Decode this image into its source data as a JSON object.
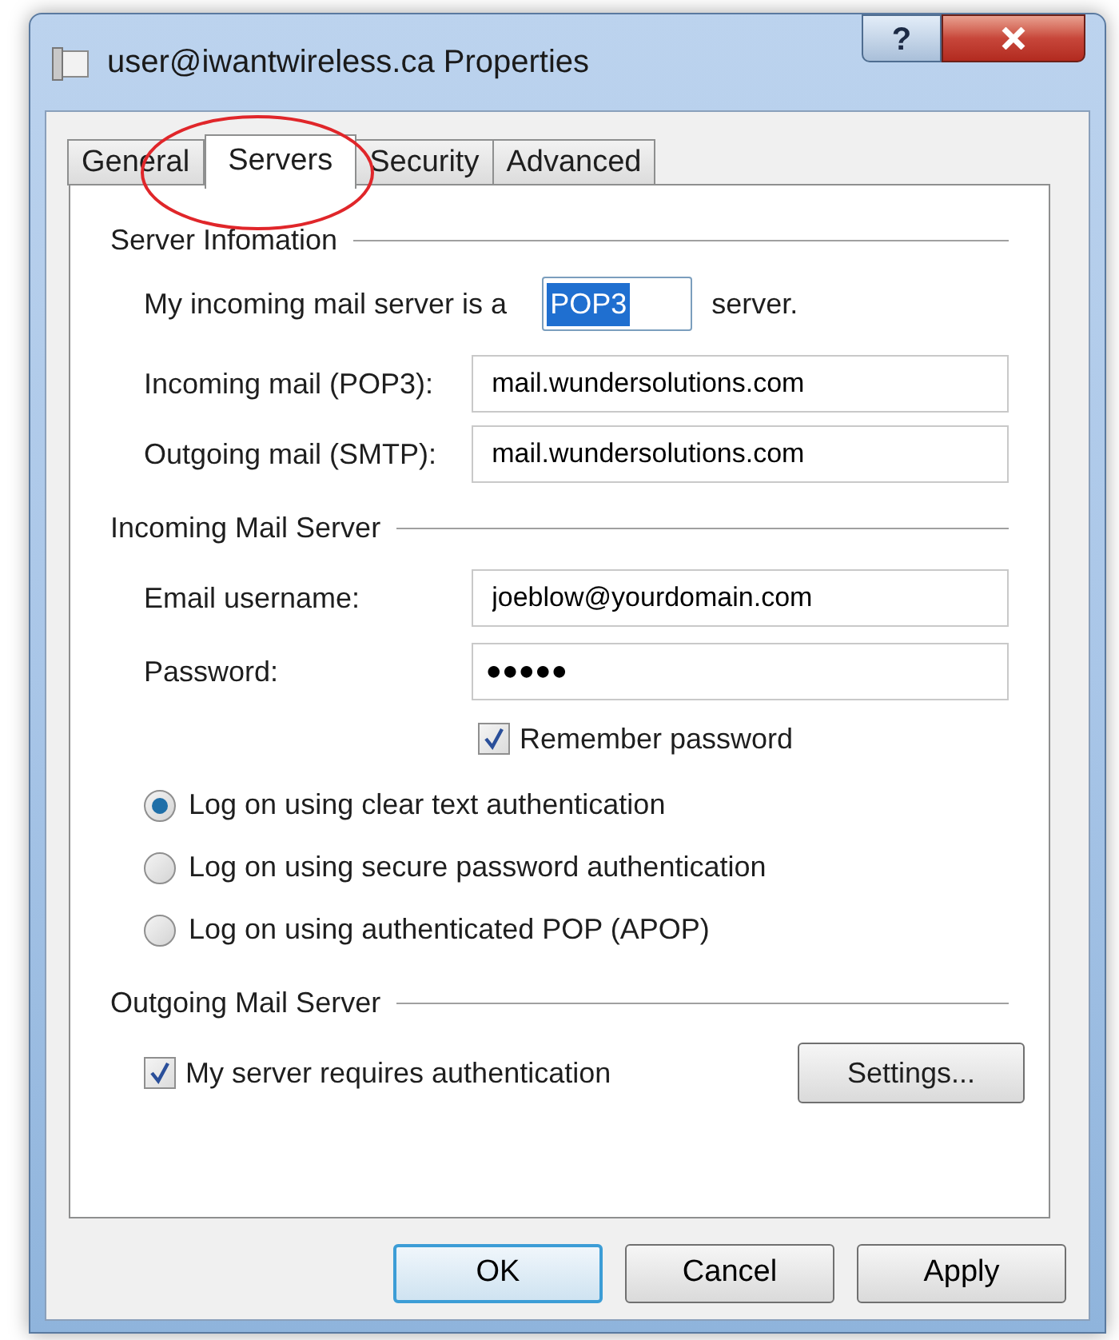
{
  "window": {
    "title": "user@iwantwireless.ca Properties",
    "help_button": "?"
  },
  "tabs": [
    {
      "label": "General",
      "selected": false,
      "circled": false
    },
    {
      "label": "Servers",
      "selected": true,
      "circled": true
    },
    {
      "label": "Security",
      "selected": false,
      "circled": false
    },
    {
      "label": "Advanced",
      "selected": false,
      "circled": false
    }
  ],
  "server_information": {
    "title": "Server Infomation",
    "server_type": {
      "label_before": "My incoming mail server is a",
      "value": "POP3",
      "value_selected": true,
      "label_after": "server."
    },
    "incoming": {
      "label": "Incoming mail (POP3):",
      "value": "mail.wundersolutions.com"
    },
    "outgoing": {
      "label": "Outgoing mail (SMTP):",
      "value": "mail.wundersolutions.com"
    }
  },
  "incoming_mail_server": {
    "title": "Incoming Mail Server",
    "username": {
      "label": "Email username:",
      "value": "joeblow@yourdomain.com"
    },
    "password": {
      "label": "Password:",
      "value": "●●●●●"
    },
    "remember_password": {
      "label": "Remember password",
      "checked": true
    },
    "auth_options": [
      {
        "label": "Log on using clear text authentication",
        "selected": true
      },
      {
        "label": "Log on using secure password authentication",
        "selected": false
      },
      {
        "label": "Log on using authenticated POP (APOP)",
        "selected": false
      }
    ]
  },
  "outgoing_mail_server": {
    "title": "Outgoing Mail Server",
    "requires_auth": {
      "label": "My server requires authentication",
      "checked": true
    },
    "settings_button": "Settings..."
  },
  "buttons": [
    {
      "label": "OK",
      "default": true
    },
    {
      "label": "Cancel",
      "default": false
    },
    {
      "label": "Apply",
      "default": false
    }
  ]
}
